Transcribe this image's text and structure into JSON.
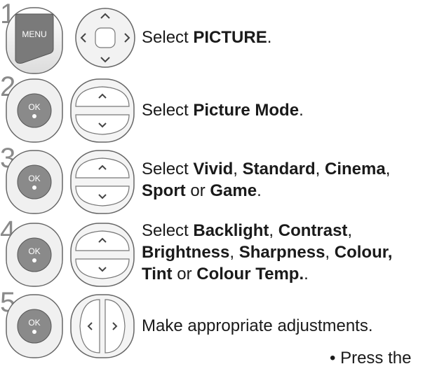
{
  "steps": [
    {
      "number": "1",
      "buttons": [
        "menu-button",
        "nav-pad-four-way"
      ],
      "menu_label": "MENU",
      "text": [
        {
          "t": "Select ",
          "b": false
        },
        {
          "t": "PICTURE",
          "b": true
        },
        {
          "t": ".",
          "b": false
        }
      ]
    },
    {
      "number": "2",
      "buttons": [
        "ok-button",
        "nav-pad-up-down"
      ],
      "ok_label": "OK",
      "text": [
        {
          "t": "Select ",
          "b": false
        },
        {
          "t": "Picture Mode",
          "b": true
        },
        {
          "t": ".",
          "b": false
        }
      ]
    },
    {
      "number": "3",
      "buttons": [
        "ok-button",
        "nav-pad-up-down"
      ],
      "ok_label": "OK",
      "text": [
        {
          "t": "Select ",
          "b": false
        },
        {
          "t": "Vivid",
          "b": true
        },
        {
          "t": ", ",
          "b": false
        },
        {
          "t": "Standard",
          "b": true
        },
        {
          "t": ", ",
          "b": false
        },
        {
          "t": "Cinema",
          "b": true
        },
        {
          "t": ",",
          "b": false
        },
        {
          "br": true
        },
        {
          "t": "Sport",
          "b": true
        },
        {
          "t": " or ",
          "b": false
        },
        {
          "t": "Game",
          "b": true
        },
        {
          "t": ".",
          "b": false
        }
      ]
    },
    {
      "number": "4",
      "buttons": [
        "ok-button",
        "nav-pad-up-down"
      ],
      "ok_label": "OK",
      "text": [
        {
          "t": "Select ",
          "b": false
        },
        {
          "t": "Backlight",
          "b": true
        },
        {
          "t": ", ",
          "b": false
        },
        {
          "t": "Contrast",
          "b": true
        },
        {
          "t": ",",
          "b": false
        },
        {
          "br": true
        },
        {
          "t": "Brightness",
          "b": true
        },
        {
          "t": ", ",
          "b": false
        },
        {
          "t": "Sharpness",
          "b": true
        },
        {
          "t": ", ",
          "b": false
        },
        {
          "t": "Colour,",
          "b": true
        },
        {
          "br": true
        },
        {
          "t": "Tint",
          "b": true
        },
        {
          "t": " or ",
          "b": false
        },
        {
          "t": "Colour Temp.",
          "b": true
        },
        {
          "t": ".",
          "b": false
        }
      ]
    },
    {
      "number": "5",
      "buttons": [
        "ok-button",
        "nav-pad-left-right"
      ],
      "ok_label": "OK",
      "text": [
        {
          "t": "Make appropriate adjustments.",
          "b": false
        }
      ]
    }
  ],
  "footer_note": "• Press the"
}
